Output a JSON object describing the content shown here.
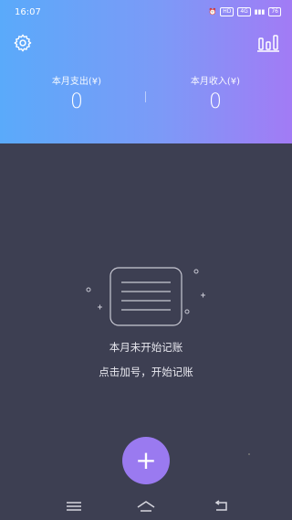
{
  "status_bar": {
    "time": "16:07",
    "signal_label_1": "HD",
    "network_label": "4G",
    "battery_label": "76"
  },
  "header": {
    "settings_icon": "gear-icon",
    "stats_icon": "bar-chart-icon",
    "expense_label": "本月支出(¥)",
    "expense_value": "0",
    "income_label": "本月收入(¥)",
    "income_value": "0"
  },
  "empty_state": {
    "illustration_icon": "empty-notebook-icon",
    "title": "本月未开始记账",
    "subtitle": "点击加号，开始记账"
  },
  "fab": {
    "label": "+"
  },
  "navbar": {
    "menu_icon": "menu-icon",
    "home_icon": "home-icon",
    "back_icon": "back-icon"
  },
  "colors": {
    "header_gradient_start": "#5aaafa",
    "header_gradient_end": "#a27bf5",
    "background": "#3d3f52",
    "fab": "#9a7af0"
  }
}
